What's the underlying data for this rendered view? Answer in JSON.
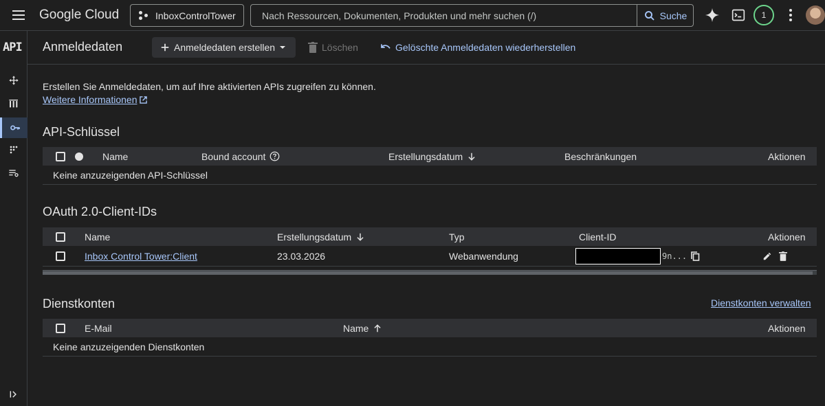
{
  "topbar": {
    "logo": "Google Cloud",
    "project": "InboxControlTower",
    "search_placeholder": "Nach Ressourcen, Dokumenten, Produkten und mehr suchen (/)",
    "search_button": "Suche",
    "notification_count": "1"
  },
  "rail": {
    "api_label": "API"
  },
  "header": {
    "title": "Anmeldedaten",
    "create_label": "Anmeldedaten erstellen",
    "delete_label": "Löschen",
    "restore_label": "Gelöschte Anmeldedaten wiederherstellen"
  },
  "intro": {
    "text": "Erstellen Sie Anmeldedaten, um auf Ihre aktivierten APIs zugreifen zu können.",
    "link": "Weitere Informationen"
  },
  "api_keys": {
    "title": "API-Schlüssel",
    "columns": [
      "Name",
      "Bound account",
      "Erstellungsdatum",
      "Beschränkungen",
      "Aktionen"
    ],
    "empty": "Keine anzuzeigenden API-Schlüssel"
  },
  "oauth": {
    "title": "OAuth 2.0-Client-IDs",
    "columns": [
      "Name",
      "Erstellungsdatum",
      "Typ",
      "Client-ID",
      "Aktionen"
    ],
    "rows": [
      {
        "name": "Inbox Control Tower:Client",
        "date": "23.03.2026",
        "type": "Webanwendung",
        "client_id_suffix": "9n..."
      }
    ]
  },
  "service_accounts": {
    "title": "Dienstkonten",
    "manage_link": "Dienstkonten verwalten",
    "columns": [
      "E-Mail",
      "Name",
      "Aktionen"
    ],
    "empty": "Keine anzuzeigenden Dienstkonten"
  },
  "colors": {
    "accent": "#a8c7fa",
    "background": "#1f1f1f",
    "header_row": "#303134"
  }
}
